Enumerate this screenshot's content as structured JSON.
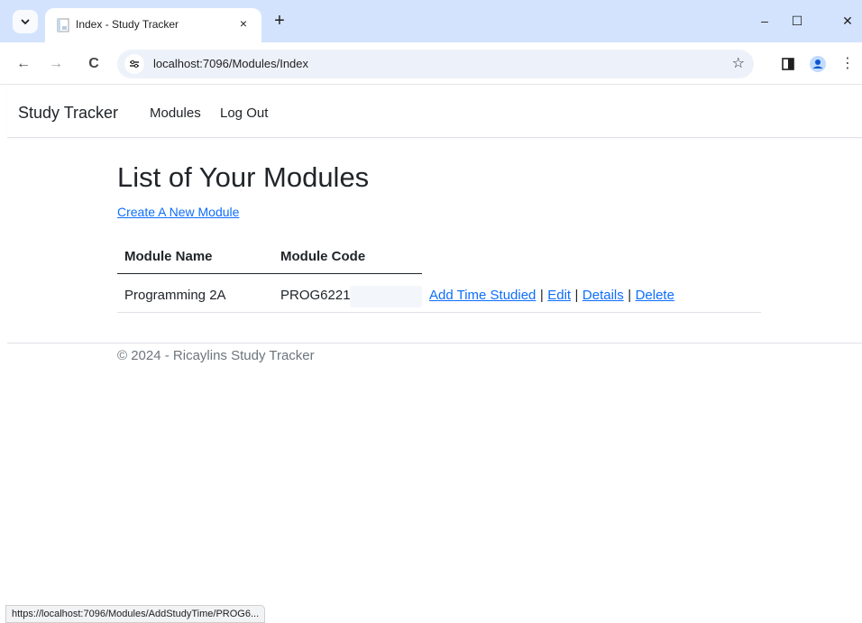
{
  "browser": {
    "tab_title": "Index - Study Tracker",
    "tab_close": "×",
    "new_tab": "+",
    "window_controls": {
      "minimize": "–",
      "maximize": "☐",
      "close": "✕"
    },
    "nav": {
      "back": "←",
      "forward": "→",
      "reload": "C"
    },
    "url": "localhost:7096/Modules/Index",
    "bookmark_star": "☆",
    "menu": "⋮",
    "status_url": "https://localhost:7096/Modules/AddStudyTime/PROG6..."
  },
  "navbar": {
    "brand": "Study Tracker",
    "links": [
      "Modules",
      "Log Out"
    ]
  },
  "main": {
    "title": "List of Your Modules",
    "create_link": "Create A New Module",
    "table": {
      "headers": [
        "Module Name",
        "Module Code"
      ],
      "rows": [
        {
          "name": "Programming 2A",
          "code": "PROG6221",
          "actions": [
            "Add Time Studied",
            "Edit",
            "Details",
            "Delete"
          ]
        }
      ],
      "separator": "|"
    }
  },
  "footer": {
    "text": "© 2024 - Ricaylins Study Tracker"
  },
  "colors": {
    "link": "#0d6efd",
    "tabstrip": "#d3e3fd",
    "omnibox": "#edf2fa"
  }
}
